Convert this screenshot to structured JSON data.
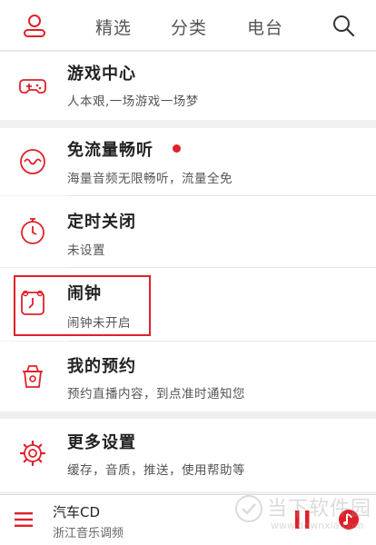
{
  "header": {
    "tabs": [
      "精选",
      "分类",
      "电台"
    ]
  },
  "menu": [
    {
      "title": "游戏中心",
      "subtitle": "人本艰,一场游戏一场梦",
      "icon": "gamepad-icon"
    },
    {
      "title": "免流量畅听",
      "subtitle": "海量音频无限畅听，流量全免",
      "icon": "wave-icon",
      "has_new_dot": true
    },
    {
      "title": "定时关闭",
      "subtitle": "未设置",
      "icon": "timer-icon"
    },
    {
      "title": "闹钟",
      "subtitle": "闹钟未开启",
      "icon": "alarm-clock-icon",
      "highlighted": true
    },
    {
      "title": "我的预约",
      "subtitle": "预约直播内容，到点准时通知您",
      "icon": "cup-icon"
    },
    {
      "title": "更多设置",
      "subtitle": "缓存，音质，推送，使用帮助等",
      "icon": "gear-icon"
    }
  ],
  "player": {
    "title": "汽车CD",
    "subtitle": "浙江音乐调频"
  },
  "watermark": {
    "text": "当下软件园",
    "url": "www.downxia.com"
  },
  "colors": {
    "accent": "#e0202a",
    "background": "#f0f0f0"
  }
}
